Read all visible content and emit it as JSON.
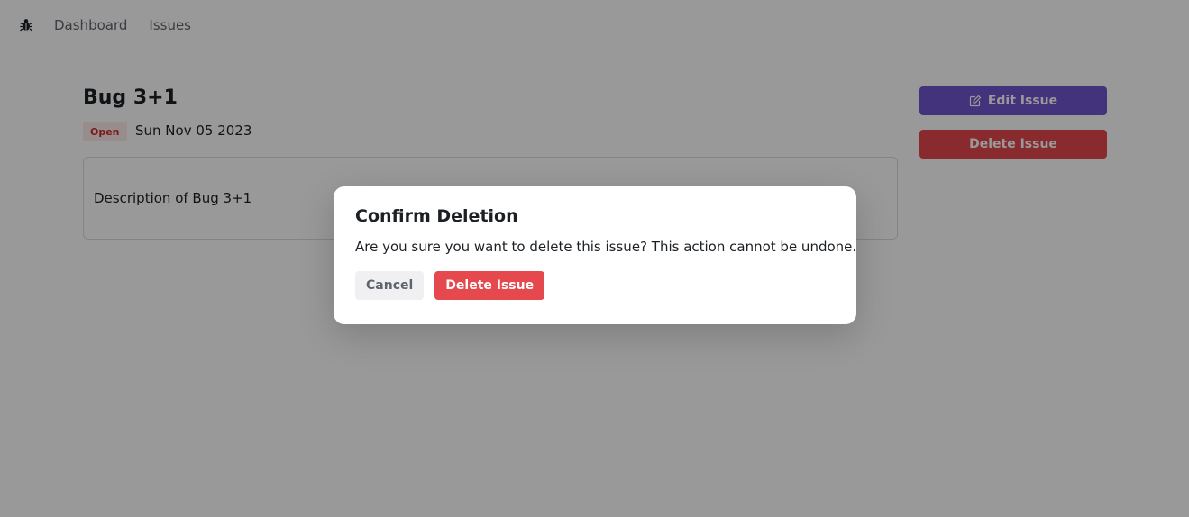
{
  "navbar": {
    "logo_icon": "bug-icon",
    "links": [
      {
        "label": "Dashboard"
      },
      {
        "label": "Issues"
      }
    ]
  },
  "issue": {
    "title": "Bug 3+1",
    "status": "Open",
    "date": "Sun Nov 05 2023",
    "description": "Description of Bug 3+1"
  },
  "actions": {
    "edit_label": "Edit Issue",
    "edit_icon": "pencil-square-icon",
    "delete_label": "Delete Issue"
  },
  "dialog": {
    "title": "Confirm Deletion",
    "description": "Are you sure you want to delete this issue? This action cannot be undone.",
    "cancel_label": "Cancel",
    "confirm_label": "Delete Issue"
  },
  "colors": {
    "accent": "#6e56cf",
    "danger": "#e5484d",
    "status_bg": "#feebec",
    "status_text": "#ce2c31"
  }
}
